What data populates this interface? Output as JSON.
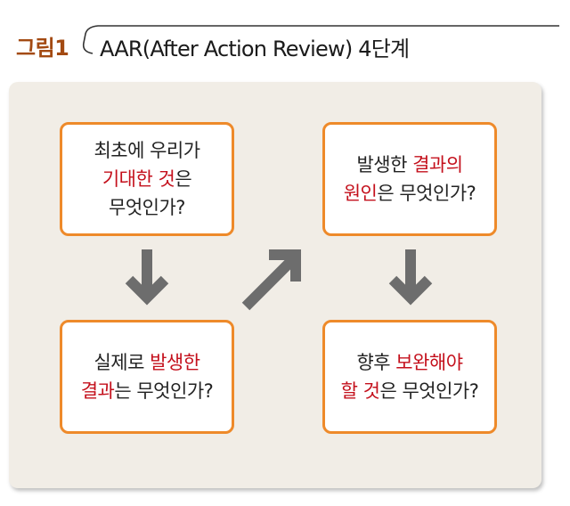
{
  "header": {
    "figure_label": "그림1",
    "title": "AAR(After Action Review) 4단계"
  },
  "steps": [
    {
      "line1": "최초에 우리가",
      "line2_hl": "기대한 것",
      "line2": "은",
      "line3": "무엇인가?"
    },
    {
      "line1": "발생한 ",
      "line1_hl": "결과의",
      "line2_hl": "원인",
      "line2": "은 무엇인가?"
    },
    {
      "line1": "실제로 ",
      "line1_hl": "발생한",
      "line2_hl": "결과",
      "line2": "는 무엇인가?"
    },
    {
      "line1": "향후 ",
      "line1_hl": "보완해야",
      "line2_hl": "할 것",
      "line2": "은 무엇인가?"
    }
  ],
  "colors": {
    "accent_red": "#c4101c",
    "box_border": "#ee8a2a",
    "arrow": "#6d6d6d",
    "panel_bg": "#f1ede6",
    "label_brown": "#a34a12"
  },
  "arrows": [
    "arrow-down-icon",
    "arrow-up-right-icon",
    "arrow-down-icon"
  ]
}
